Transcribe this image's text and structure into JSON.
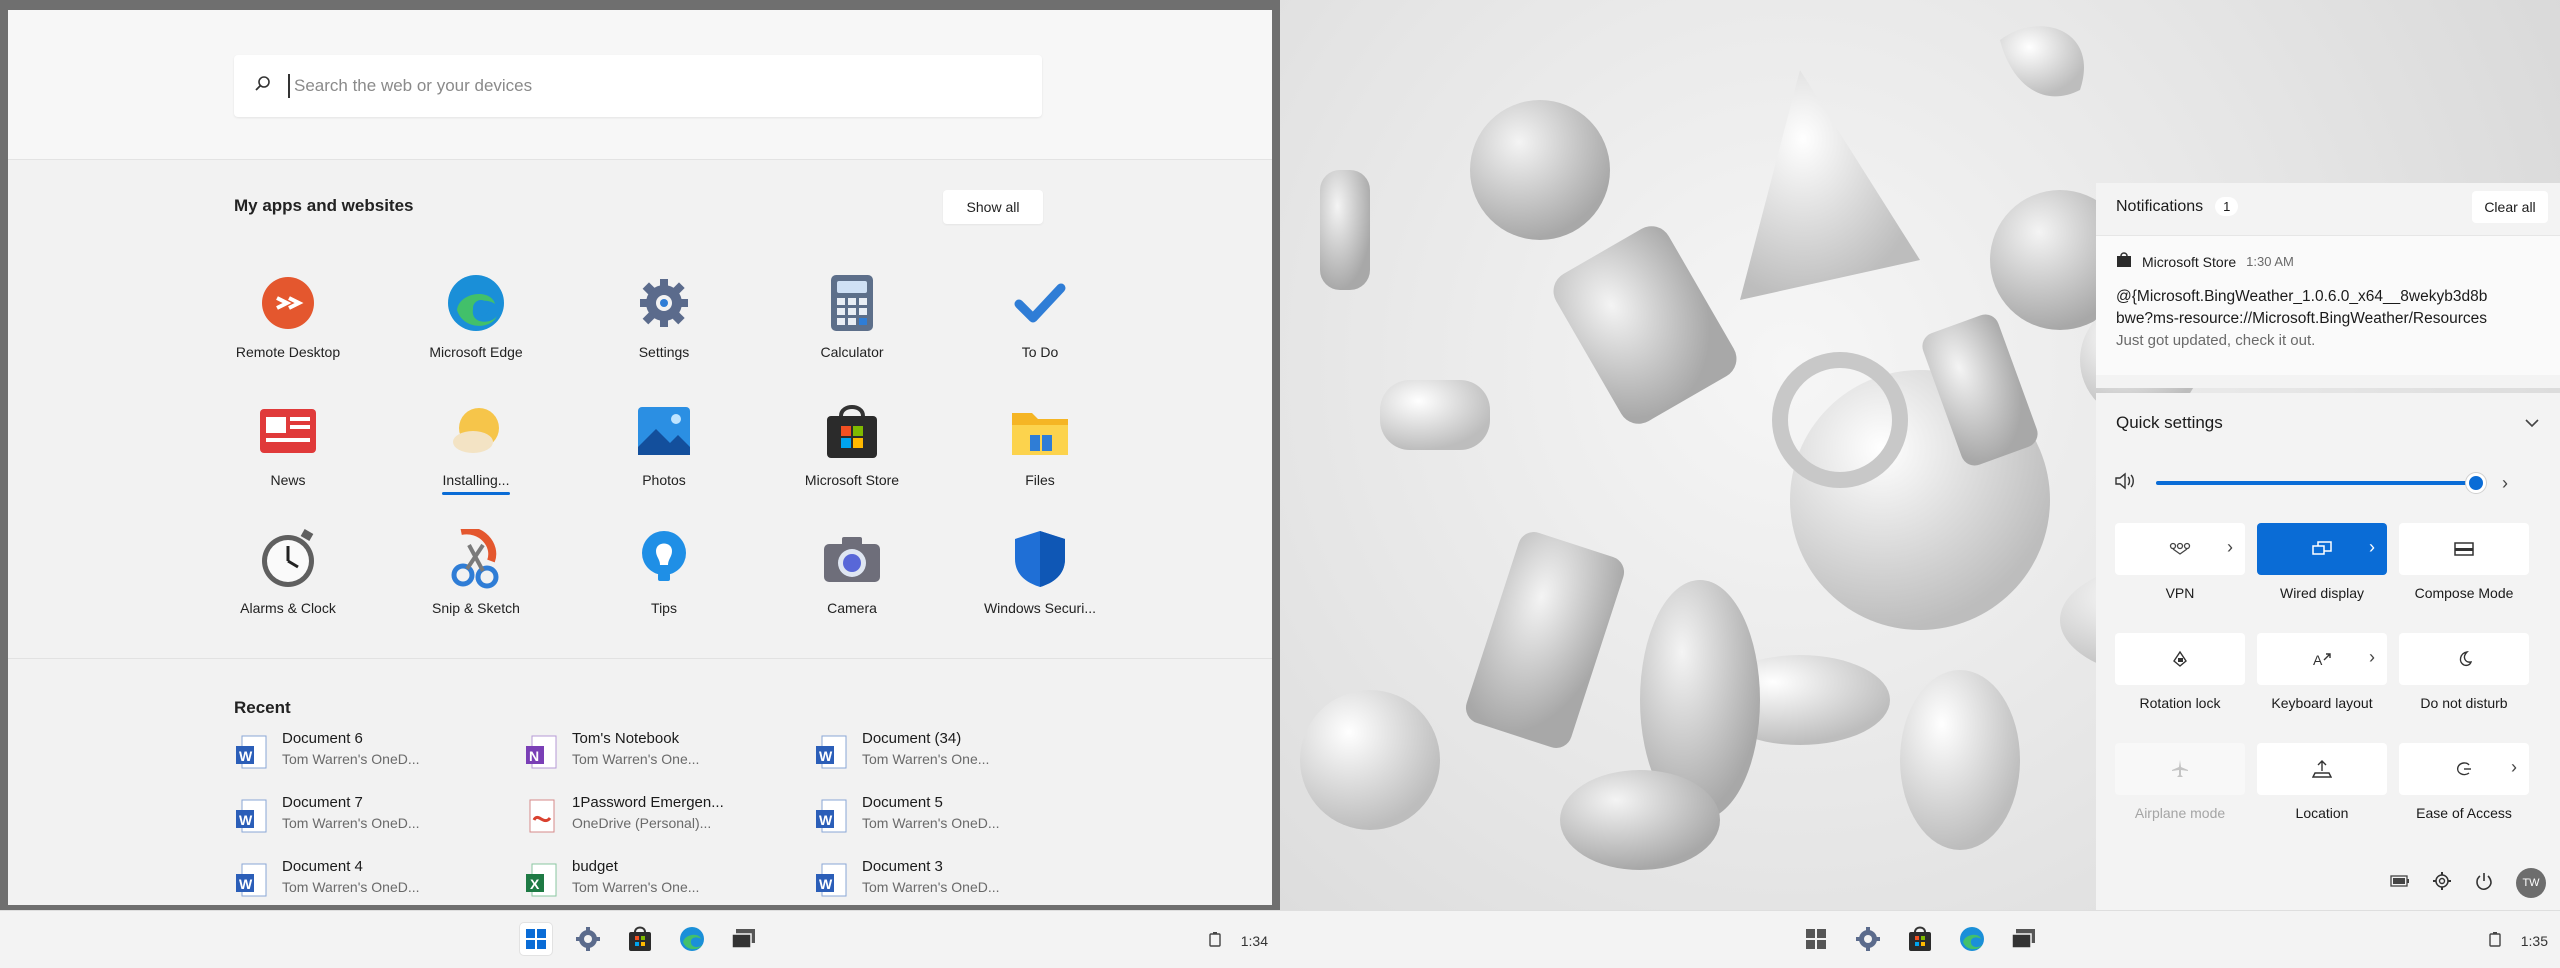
{
  "left": {
    "search": {
      "placeholder": "Search the web or your devices"
    },
    "apps_section": {
      "title": "My apps and websites",
      "show_all": "Show all",
      "apps": [
        {
          "label": "Remote Desktop",
          "icon": "remote-desktop-icon"
        },
        {
          "label": "Microsoft Edge",
          "icon": "edge-icon"
        },
        {
          "label": "Settings",
          "icon": "gear-icon"
        },
        {
          "label": "Calculator",
          "icon": "calculator-icon"
        },
        {
          "label": "To Do",
          "icon": "check-icon"
        },
        {
          "label": "News",
          "icon": "news-icon"
        },
        {
          "label": "Installing...",
          "icon": "weather-icon"
        },
        {
          "label": "Photos",
          "icon": "photos-icon"
        },
        {
          "label": "Microsoft Store",
          "icon": "store-icon"
        },
        {
          "label": "Files",
          "icon": "folder-icon"
        },
        {
          "label": "Alarms & Clock",
          "icon": "clock-icon"
        },
        {
          "label": "Snip & Sketch",
          "icon": "scissors-icon"
        },
        {
          "label": "Tips",
          "icon": "lightbulb-icon"
        },
        {
          "label": "Camera",
          "icon": "camera-icon"
        },
        {
          "label": "Windows Securi...",
          "icon": "shield-icon"
        }
      ]
    },
    "recent": {
      "title": "Recent",
      "items": [
        {
          "name": "Document 6",
          "location": "Tom Warren's OneD...",
          "type": "word"
        },
        {
          "name": "Tom's Notebook",
          "location": "Tom Warren's One...",
          "type": "onenote"
        },
        {
          "name": "Document (34)",
          "location": "Tom Warren's One...",
          "type": "word"
        },
        {
          "name": "Document 7",
          "location": "Tom Warren's OneD...",
          "type": "word"
        },
        {
          "name": "1Password Emergen...",
          "location": "OneDrive (Personal)...",
          "type": "pdf"
        },
        {
          "name": "Document 5",
          "location": "Tom Warren's OneD...",
          "type": "word"
        },
        {
          "name": "Document 4",
          "location": "Tom Warren's OneD...",
          "type": "word"
        },
        {
          "name": "budget",
          "location": "Tom Warren's One...",
          "type": "excel"
        },
        {
          "name": "Document 3",
          "location": "Tom Warren's OneD...",
          "type": "word"
        }
      ]
    },
    "taskbar": {
      "time": "1:34"
    }
  },
  "right": {
    "notifications": {
      "title": "Notifications",
      "count": "1",
      "clear_all": "Clear all",
      "item": {
        "app": "Microsoft Store",
        "time": "1:30 AM",
        "line1": "@{Microsoft.BingWeather_1.0.6.0_x64__8wekyb3d8b",
        "line2": "bwe?ms-resource://Microsoft.BingWeather/Resources",
        "line3": "Just got updated, check it out."
      }
    },
    "quick_settings": {
      "title": "Quick settings",
      "volume": 1.0,
      "tiles": [
        {
          "label": "VPN",
          "icon": "vpn-icon",
          "state": "off",
          "expand": true
        },
        {
          "label": "Wired display",
          "icon": "wired-display-icon",
          "state": "on",
          "expand": true
        },
        {
          "label": "Compose Mode",
          "icon": "compose-mode-icon",
          "state": "off",
          "expand": false
        },
        {
          "label": "Rotation lock",
          "icon": "rotation-lock-icon",
          "state": "off",
          "expand": false
        },
        {
          "label": "Keyboard layout",
          "icon": "keyboard-layout-icon",
          "state": "off",
          "expand": true
        },
        {
          "label": "Do not disturb",
          "icon": "moon-icon",
          "state": "off",
          "expand": false
        },
        {
          "label": "Airplane mode",
          "icon": "airplane-icon",
          "state": "disabled",
          "expand": false
        },
        {
          "label": "Location",
          "icon": "location-icon",
          "state": "off",
          "expand": false
        },
        {
          "label": "Ease of Access",
          "icon": "ease-of-access-icon",
          "state": "off",
          "expand": true
        }
      ],
      "avatar_initials": "TW"
    },
    "taskbar": {
      "time": "1:35"
    }
  },
  "colors": {
    "accent": "#0a6cd6",
    "panel": "#f3f3f3"
  }
}
